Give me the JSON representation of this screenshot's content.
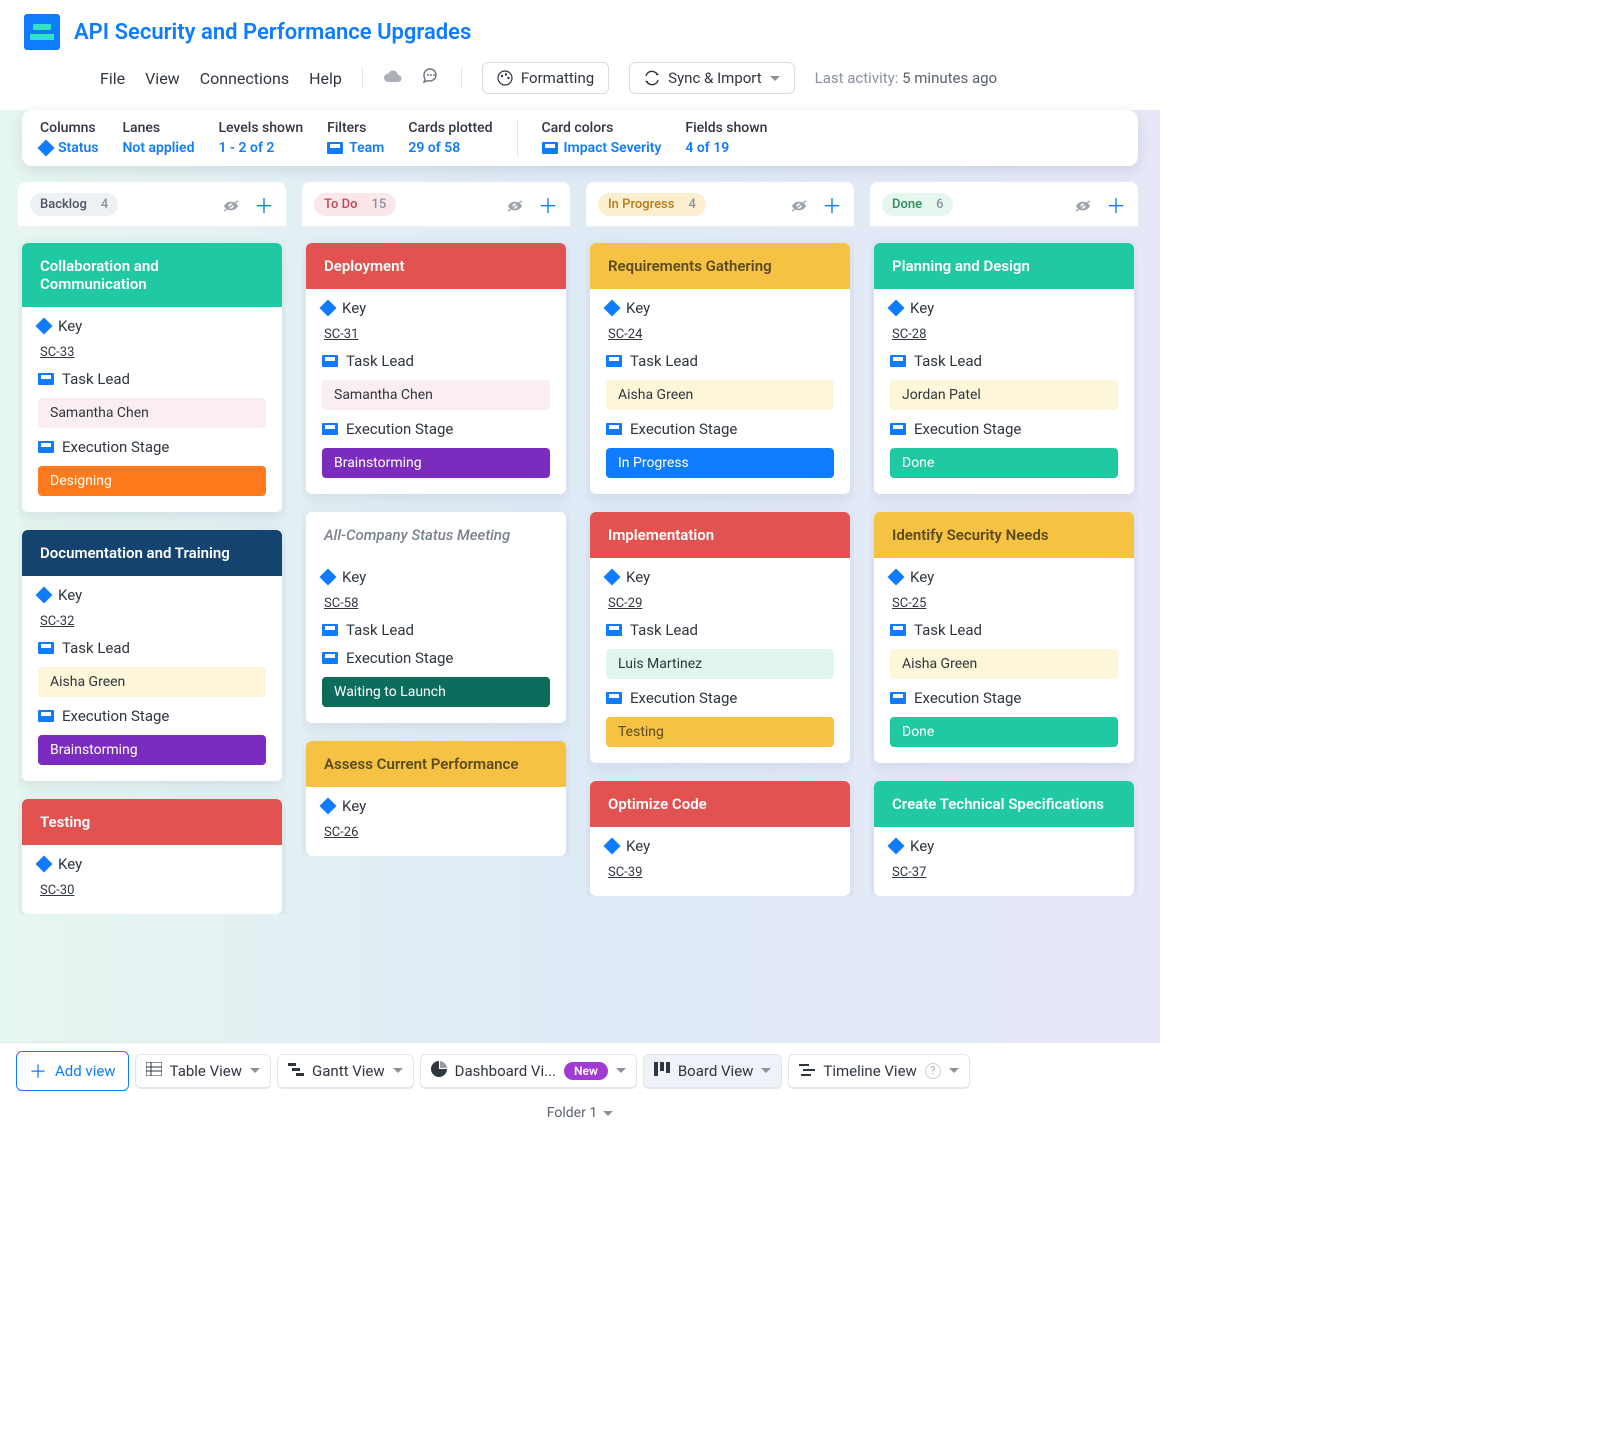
{
  "title": "API Security and Performance Upgrades",
  "menu": {
    "file": "File",
    "view": "View",
    "connections": "Connections",
    "help": "Help",
    "formatting": "Formatting",
    "sync": "Sync & Import"
  },
  "last_activity": {
    "label": "Last activity:",
    "time": "5 minutes ago"
  },
  "filters": {
    "columns": {
      "label": "Columns",
      "value": "Status"
    },
    "lanes": {
      "label": "Lanes",
      "value": "Not applied"
    },
    "levels": {
      "label": "Levels shown",
      "value": "1 - 2 of 2"
    },
    "fltr": {
      "label": "Filters",
      "value": "Team"
    },
    "plotted": {
      "label": "Cards plotted",
      "value": "29 of 58"
    },
    "colors": {
      "label": "Card colors",
      "value": "Impact Severity"
    },
    "fields": {
      "label": "Fields shown",
      "value": "4 of 19"
    }
  },
  "field_labels": {
    "key": "Key",
    "lead": "Task Lead",
    "stage": "Execution Stage"
  },
  "columns": [
    {
      "name": "Backlog",
      "count": 4,
      "pill": "pill-grey",
      "cards": [
        {
          "title": "Collaboration and Communication",
          "head": "h-green",
          "key": "SC-33",
          "lead": "Samantha Chen",
          "lead_cls": "c-lead-pink",
          "stage": "Designing",
          "stage_cls": "c-designing"
        },
        {
          "title": "Documentation and Training",
          "head": "h-navy",
          "key": "SC-32",
          "lead": "Aisha Green",
          "lead_cls": "c-lead-yellow",
          "stage": "Brainstorming",
          "stage_cls": "c-brainstorm"
        },
        {
          "title": "Testing",
          "head": "h-red",
          "key": "SC-30"
        }
      ]
    },
    {
      "name": "To Do",
      "count": 15,
      "pill": "pill-pink",
      "cards": [
        {
          "title": "Deployment",
          "head": "h-red",
          "key": "SC-31",
          "lead": "Samantha Chen",
          "lead_cls": "c-lead-pink",
          "stage": "Brainstorming",
          "stage_cls": "c-brainstorm"
        },
        {
          "title": "All-Company Status Meeting",
          "head": "h-white",
          "italic": true,
          "key": "SC-58",
          "lead": "",
          "stage": "Waiting to Launch",
          "stage_cls": "c-waiting"
        },
        {
          "title": "Assess Current Performance",
          "head": "h-gold",
          "headtxt": "h-yellowtxt",
          "key": "SC-26"
        }
      ]
    },
    {
      "name": "In Progress",
      "count": 4,
      "pill": "pill-gold",
      "cards": [
        {
          "title": "Requirements Gathering",
          "head": "h-gold",
          "headtxt": "h-yellowtxt",
          "key": "SC-24",
          "lead": "Aisha Green",
          "lead_cls": "c-lead-yellow",
          "stage": "In Progress",
          "stage_cls": "c-inprogress"
        },
        {
          "title": "Implementation",
          "head": "h-red",
          "key": "SC-29",
          "lead": "Luis Martinez",
          "lead_cls": "c-lead-mint",
          "stage": "Testing",
          "stage_cls": "c-testing"
        },
        {
          "title": "Optimize Code",
          "head": "h-red",
          "key": "SC-39"
        }
      ]
    },
    {
      "name": "Done",
      "count": 6,
      "pill": "pill-green",
      "cards": [
        {
          "title": "Planning and Design",
          "head": "h-green",
          "key": "SC-28",
          "lead": "Jordan Patel",
          "lead_cls": "c-lead-yellow",
          "stage": "Done",
          "stage_cls": "c-done"
        },
        {
          "title": "Identify Security Needs",
          "head": "h-gold",
          "headtxt": "h-yellowtxt",
          "key": "SC-25",
          "lead": "Aisha Green",
          "lead_cls": "c-lead-yellow",
          "stage": "Done",
          "stage_cls": "c-done"
        },
        {
          "title": "Create Technical Specifications",
          "head": "h-green",
          "key": "SC-37"
        }
      ]
    }
  ],
  "views": {
    "add": "Add view",
    "tabs": [
      {
        "label": "Table View",
        "icon": "table"
      },
      {
        "label": "Gantt View",
        "icon": "gantt"
      },
      {
        "label": "Dashboard Vi...",
        "icon": "pie",
        "new": "New"
      },
      {
        "label": "Board View",
        "icon": "board",
        "active": true
      },
      {
        "label": "Timeline View",
        "icon": "timeline",
        "help": true
      }
    ]
  },
  "folder": "Folder 1"
}
